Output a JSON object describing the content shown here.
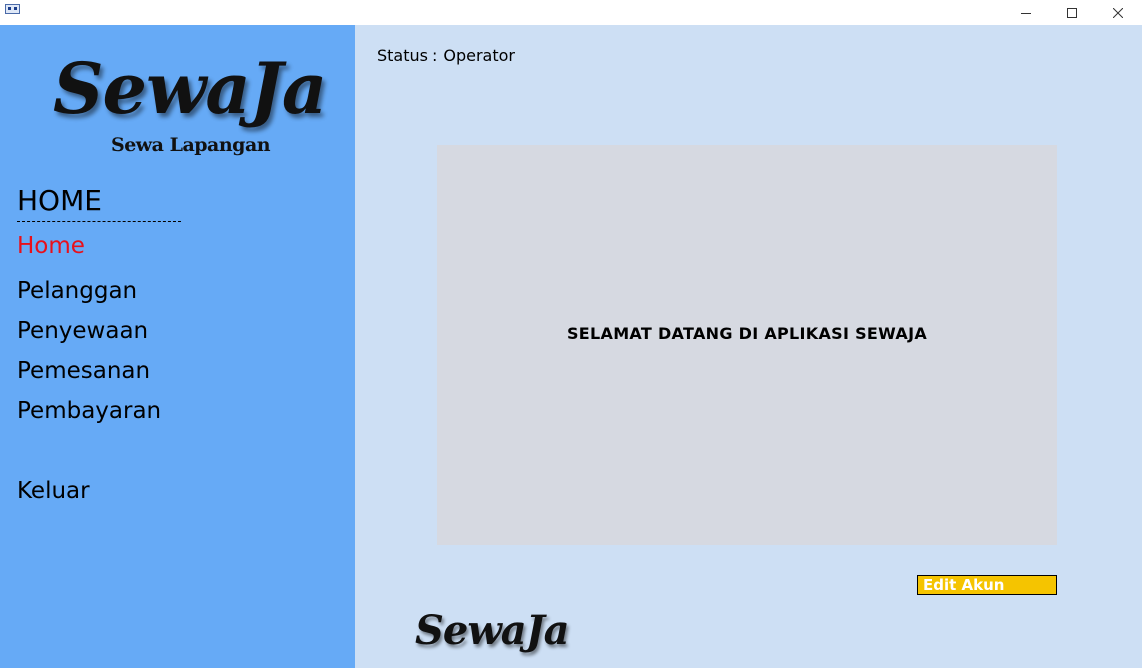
{
  "window": {
    "icon": "app-icon",
    "controls": [
      "minimize-icon",
      "maximize-icon",
      "close-icon"
    ]
  },
  "logo": {
    "word": "SewaJa",
    "subtitle": "Sewa Lapangan"
  },
  "sidebar": {
    "title": "HOME",
    "items": [
      {
        "label": "Home",
        "active": true
      },
      {
        "label": "Pelanggan"
      },
      {
        "label": "Penyewaan"
      },
      {
        "label": "Pemesanan"
      },
      {
        "label": "Pembayaran"
      },
      {
        "label": "Keluar"
      }
    ],
    "active_color": "#e8101b",
    "background": "#66aaf6"
  },
  "main": {
    "status_label": "Status",
    "status_separator": ":",
    "status_value": "Operator",
    "welcome": "SELAMAT DATANG DI APLIKASI SEWAJA",
    "edit_button": "Edit Akun",
    "edit_button_color": "#f5c400",
    "footer_logo": "SewaJa",
    "background": "#cddff4"
  }
}
